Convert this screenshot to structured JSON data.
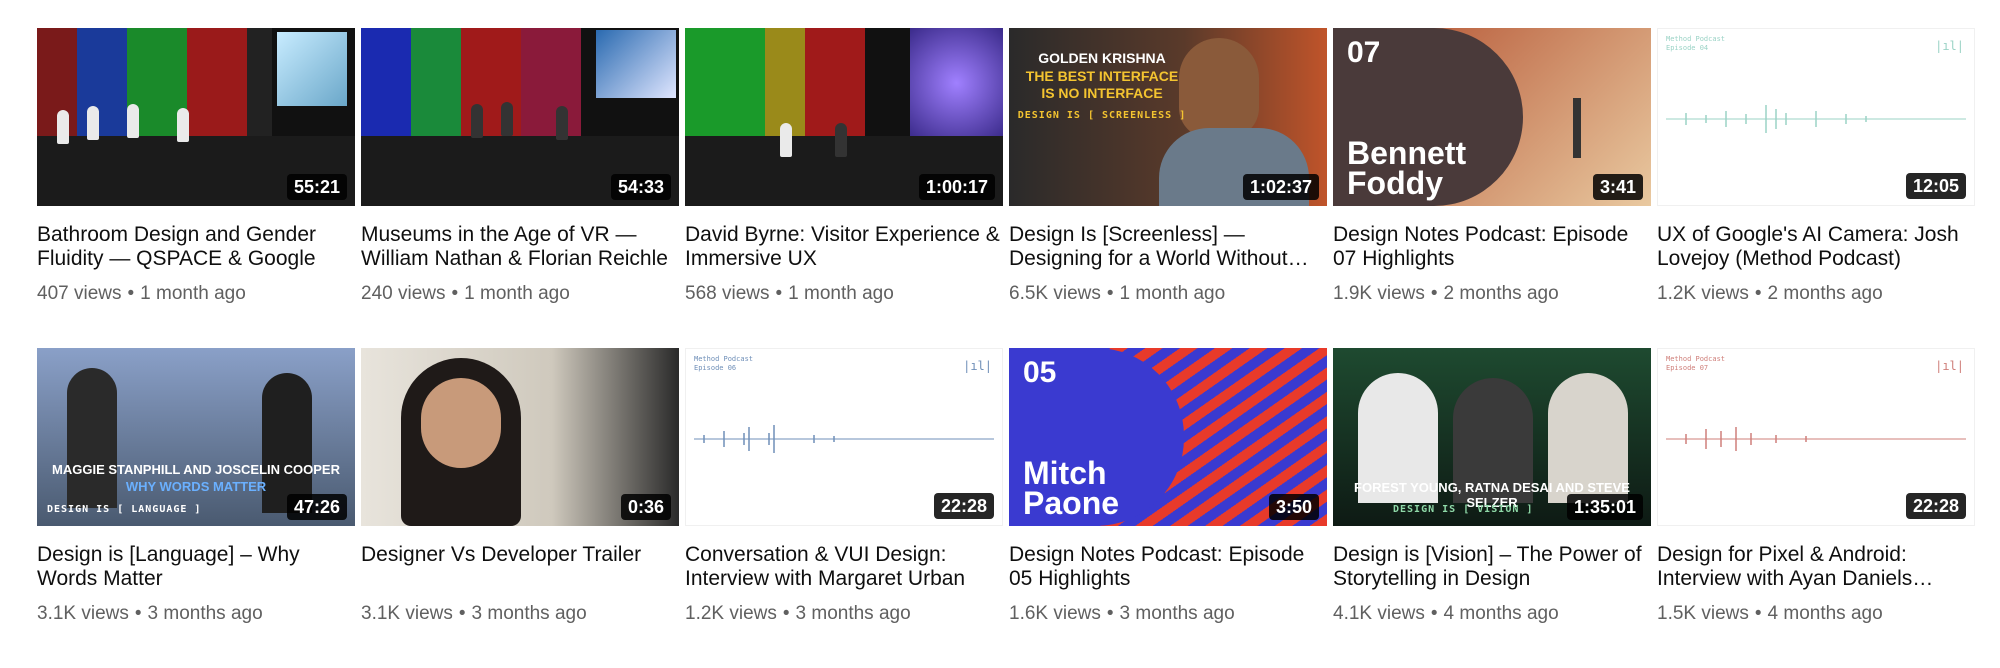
{
  "videos": [
    {
      "title": "Bathroom Design and Gender Fluidity — QSPACE & Google",
      "views": "407 views",
      "age": "1 month ago",
      "duration": "55:21"
    },
    {
      "title": "Museums in the Age of VR — William Nathan & Florian Reichle",
      "views": "240 views",
      "age": "1 month ago",
      "duration": "54:33"
    },
    {
      "title": "David Byrne: Visitor Experience & Immersive UX",
      "views": "568 views",
      "age": "1 month ago",
      "duration": "1:00:17"
    },
    {
      "title": "Design Is [Screenless] — Designing for a World Without Screens",
      "views": "6.5K views",
      "age": "1 month ago",
      "duration": "1:02:37",
      "caption_line1": "Golden Krishna",
      "caption_line2": "The best interface",
      "caption_line3": "is no interface",
      "caption_line4": "Design is [ Screenless ]"
    },
    {
      "title": "Design Notes Podcast: Episode 07 Highlights",
      "views": "1.9K views",
      "age": "2 months ago",
      "duration": "3:41",
      "episode_num": "07",
      "episode_name_1": "Bennett",
      "episode_name_2": "Foddy"
    },
    {
      "title": "UX of Google's AI Camera: Josh Lovejoy (Method Podcast)",
      "views": "1.2K views",
      "age": "2 months ago",
      "duration": "12:05",
      "podcast_label": "Method Podcast",
      "podcast_ep": "Episode 04"
    },
    {
      "title": "Design is [Language] – Why Words Matter",
      "views": "3.1K views",
      "age": "3 months ago",
      "duration": "47:26",
      "caption_line1": "Maggie Stanphill and Joscelin Cooper",
      "caption_line2": "Why Words Matter",
      "caption_line3": "Design is [ Language ]"
    },
    {
      "title": "Designer Vs Developer Trailer",
      "views": "3.1K views",
      "age": "3 months ago",
      "duration": "0:36"
    },
    {
      "title": "Conversation & VUI Design: Interview with Margaret Urban",
      "views": "1.2K views",
      "age": "3 months ago",
      "duration": "22:28",
      "podcast_label": "Method Podcast",
      "podcast_ep": "Episode 06"
    },
    {
      "title": "Design Notes Podcast: Episode 05 Highlights",
      "views": "1.6K views",
      "age": "3 months ago",
      "duration": "3:50",
      "episode_num": "05",
      "episode_name_1": "Mitch",
      "episode_name_2": "Paone"
    },
    {
      "title": "Design is [Vision] – The Power of Storytelling in Design",
      "views": "4.1K views",
      "age": "4 months ago",
      "duration": "1:35:01",
      "caption_line1": "Forest Young, Ratna Desai and Steve Selzer",
      "caption_line2": "Design is [ Vision ]"
    },
    {
      "title": "Design for Pixel & Android: Interview with Ayan Daniels (Method Podcast)",
      "views": "1.5K views",
      "age": "4 months ago",
      "duration": "22:28",
      "podcast_label": "Method Podcast",
      "podcast_ep": "Episode 07"
    }
  ],
  "colors": {
    "waveform_teal": "#9bd3c6",
    "waveform_blue": "#6f8fb8",
    "waveform_red": "#cf7f7a",
    "episode07_bg": "#4a3a3a",
    "episode05_bg": "#3a3ad0",
    "episode05_accent": "#e83a2a"
  }
}
